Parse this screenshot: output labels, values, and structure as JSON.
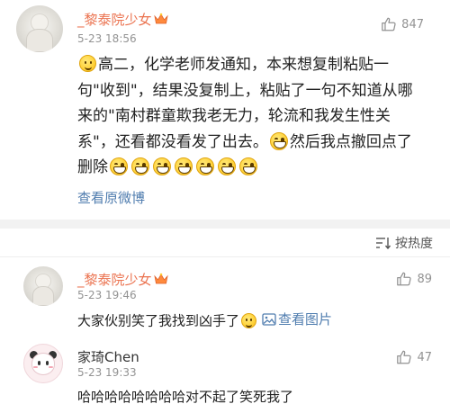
{
  "main_comment": {
    "username": "_黎泰院少女",
    "timestamp": "5-23 18:56",
    "like_count": "847",
    "text_part1": "高二，化学老师发通知，本来想复制粘贴一句\"收到\"，结果没复制上，粘贴了一句不知道从哪来的\"南村群童欺我老无力，轮流和我发生性关系\"，还看都没看发了出去。",
    "text_part2": "然后我点撤回点了删除",
    "leading_emoji": "smile-emoji",
    "inline_emoji": "grin-emoji",
    "trailing_emoji_count": 7,
    "view_original_label": "查看原微博"
  },
  "sort_bar": {
    "label": "按热度",
    "icon": "sort-icon"
  },
  "replies": [
    {
      "username": "_黎泰院少女",
      "timestamp": "5-23 19:46",
      "like_count": "89",
      "text": "大家伙别笑了我找到凶手了",
      "emoji": "smile-emoji",
      "image_link_label": "查看图片",
      "avatar_style": "photo"
    },
    {
      "username": "家琦Chen",
      "timestamp": "5-23 19:33",
      "like_count": "47",
      "text": "哈哈哈哈哈哈哈哈对不起了笑死我了",
      "avatar_style": "cartoon"
    }
  ],
  "colors": {
    "username_accent": "#eb7350",
    "link_blue": "#507daf",
    "meta_gray": "#939393",
    "divider_band": "#f2f2f2"
  }
}
